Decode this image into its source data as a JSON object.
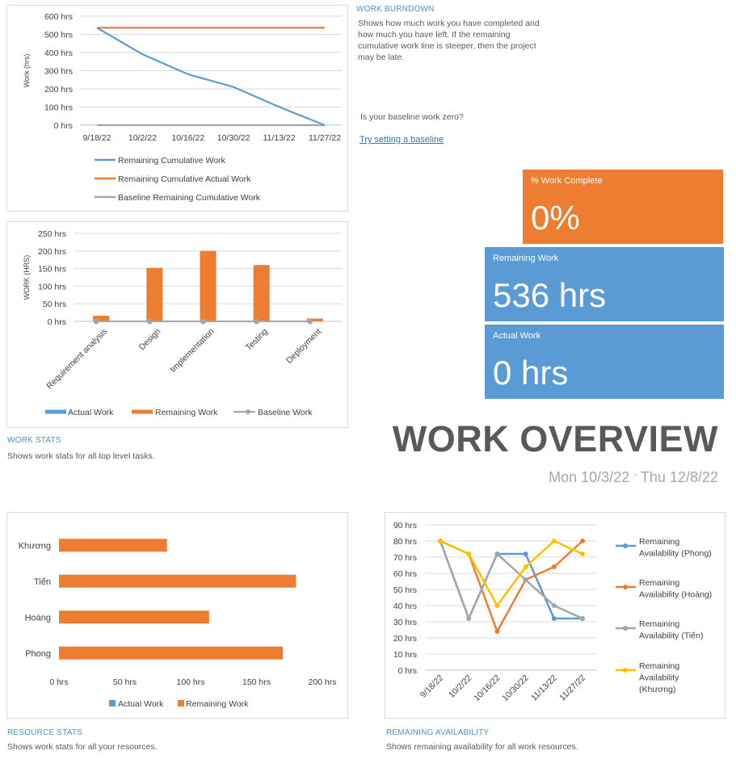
{
  "burndown": {
    "title": "WORK BURNDOWN",
    "description": "Shows how much work you have completed and how much you have left. If the remaining cumulative work line is steeper, then the project may be late.",
    "baseline_question": "Is your baseline work zero?",
    "baseline_link": "Try setting a baseline"
  },
  "tiles": {
    "pct_label": "% Work Complete",
    "pct_value": "0%",
    "remaining_label": "Remaining Work",
    "remaining_value": "536 hrs",
    "actual_label": "Actual Work",
    "actual_value": "0 hrs"
  },
  "overview": {
    "title": "WORK OVERVIEW",
    "start": "Mon 10/3/22",
    "separator": "-",
    "end": "Thu 12/8/22"
  },
  "work_stats": {
    "title": "WORK STATS",
    "description": "Shows work stats for all top level tasks."
  },
  "resource_stats": {
    "title": "RESOURCE STATS",
    "description": "Shows work stats for all your resources."
  },
  "remaining_availability": {
    "title": "REMAINING AVAILABILITY",
    "description": "Shows remaining availability for all work resources."
  },
  "colors": {
    "blue": "#5b9bd5",
    "orange": "#ed7d31",
    "gray": "#a5a5a5",
    "yellow": "#ffc000",
    "tile_orange": "#ed7d31",
    "tile_blue": "#5b9bd5"
  },
  "chart_data": [
    {
      "id": "burndown",
      "type": "line",
      "x": [
        "9/18/22",
        "10/2/22",
        "10/16/22",
        "10/30/22",
        "11/13/22",
        "11/27/22"
      ],
      "ylabel": "Work (hrs)",
      "yticks": [
        "0 hrs",
        "100 hrs",
        "200 hrs",
        "300 hrs",
        "400 hrs",
        "500 hrs",
        "600 hrs"
      ],
      "ylim": [
        0,
        600
      ],
      "grid": true,
      "legend": "bottom",
      "series": [
        {
          "name": "Remaining Cumulative Work",
          "values": [
            536,
            390,
            280,
            210,
            100,
            0
          ]
        },
        {
          "name": "Remaining Cumulative Actual Work",
          "values": [
            536,
            536,
            536,
            536,
            536,
            536
          ]
        },
        {
          "name": "Baseline Remaining Cumulative Work",
          "values": [
            0,
            0,
            0,
            0,
            0,
            0
          ]
        }
      ]
    },
    {
      "id": "work_stats",
      "type": "bar",
      "categories": [
        "Requirement analysis",
        "Design",
        "Implementation",
        "Testing",
        "Deployment"
      ],
      "ylabel": "WORK (HRS)",
      "yticks": [
        "0 hrs",
        "50 hrs",
        "100 hrs",
        "150 hrs",
        "200 hrs",
        "250 hrs"
      ],
      "ylim": [
        0,
        250
      ],
      "grid": true,
      "legend": "bottom",
      "series": [
        {
          "name": "Actual Work",
          "values": [
            0,
            0,
            0,
            0,
            0
          ]
        },
        {
          "name": "Remaining Work",
          "values": [
            16,
            152,
            200,
            160,
            8
          ]
        },
        {
          "name": "Baseline Work",
          "values": [
            0,
            0,
            0,
            0,
            0
          ]
        }
      ]
    },
    {
      "id": "resource_stats",
      "type": "bar",
      "orientation": "horizontal",
      "categories": [
        "Khương",
        "Tiến",
        "Hoàng",
        "Phong"
      ],
      "xticks": [
        "0 hrs",
        "50 hrs",
        "100 hrs",
        "150 hrs",
        "200 hrs"
      ],
      "xlim": [
        0,
        200
      ],
      "legend": "bottom",
      "series": [
        {
          "name": "Actual Work",
          "values": [
            0,
            0,
            0,
            0
          ]
        },
        {
          "name": "Remaining Work",
          "values": [
            82,
            180,
            114,
            170
          ]
        }
      ]
    },
    {
      "id": "remaining_availability",
      "type": "line",
      "x": [
        "9/18/22",
        "10/2/22",
        "10/16/22",
        "10/30/22",
        "11/13/22",
        "11/27/22"
      ],
      "yticks": [
        "0 hrs",
        "10 hrs",
        "20 hrs",
        "30 hrs",
        "40 hrs",
        "50 hrs",
        "60 hrs",
        "70 hrs",
        "80 hrs",
        "90 hrs"
      ],
      "ylim": [
        0,
        90
      ],
      "grid": true,
      "legend": "right",
      "series": [
        {
          "name": "Remaining Availability (Phong)",
          "values": [
            80,
            32,
            72,
            72,
            32,
            32
          ]
        },
        {
          "name": "Remaining Availability (Hoàng)",
          "values": [
            80,
            72,
            24,
            56,
            64,
            80
          ]
        },
        {
          "name": "Remaining Availability (Tiến)",
          "values": [
            80,
            32,
            72,
            56,
            40,
            32
          ]
        },
        {
          "name": "Remaining Availability (Khương)",
          "values": [
            80,
            72,
            40,
            64,
            80,
            72
          ]
        }
      ]
    }
  ]
}
